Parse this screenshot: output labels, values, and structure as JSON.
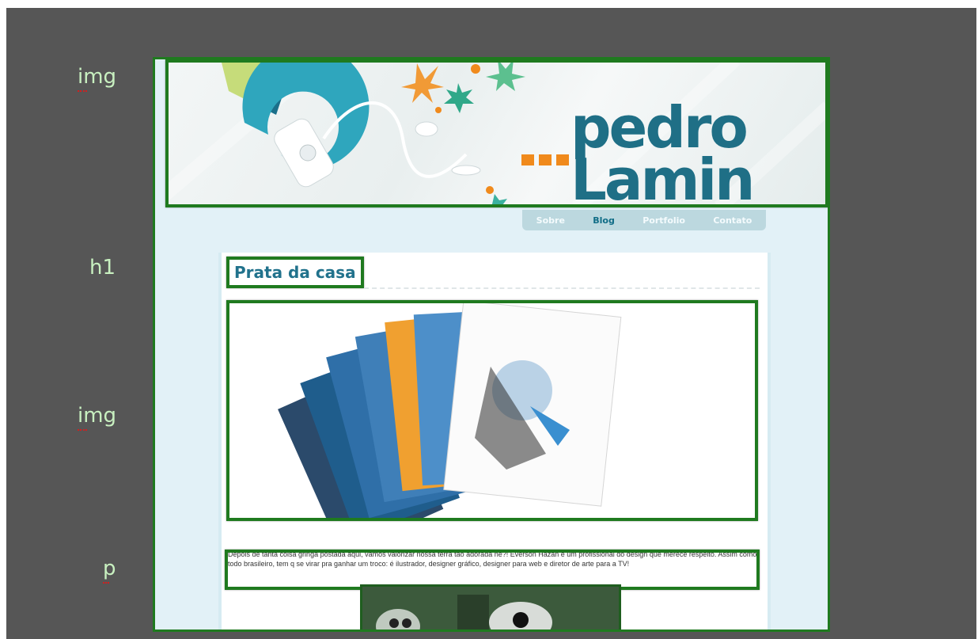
{
  "outline_labels": {
    "banner_tag": "img",
    "heading_tag": "h1",
    "figure_tag": "img",
    "paragraph_tag": "p"
  },
  "site": {
    "logo_line1": "pedro",
    "logo_line2": "Lamin",
    "logo_dots": "...",
    "brand_color": "#1f6f86",
    "accent_color": "#f08a1c"
  },
  "nav": {
    "items": [
      "Sobre",
      "Blog",
      "Portfolio",
      "Contato"
    ],
    "active": "Blog"
  },
  "post": {
    "title": "Prata da casa",
    "body": "Depois de tanta coisa gringa postada aqui, vamos valorizar nossa terra tão adorada né?! Everson Hazan é um profissional do design que merece respeito. Assim como todo brasileiro, tem q se virar pra ganhar um troco: é ilustrador, designer gráfico, designer para web e diretor de arte para a TV!"
  },
  "highlight_color": "#1f7a1f"
}
